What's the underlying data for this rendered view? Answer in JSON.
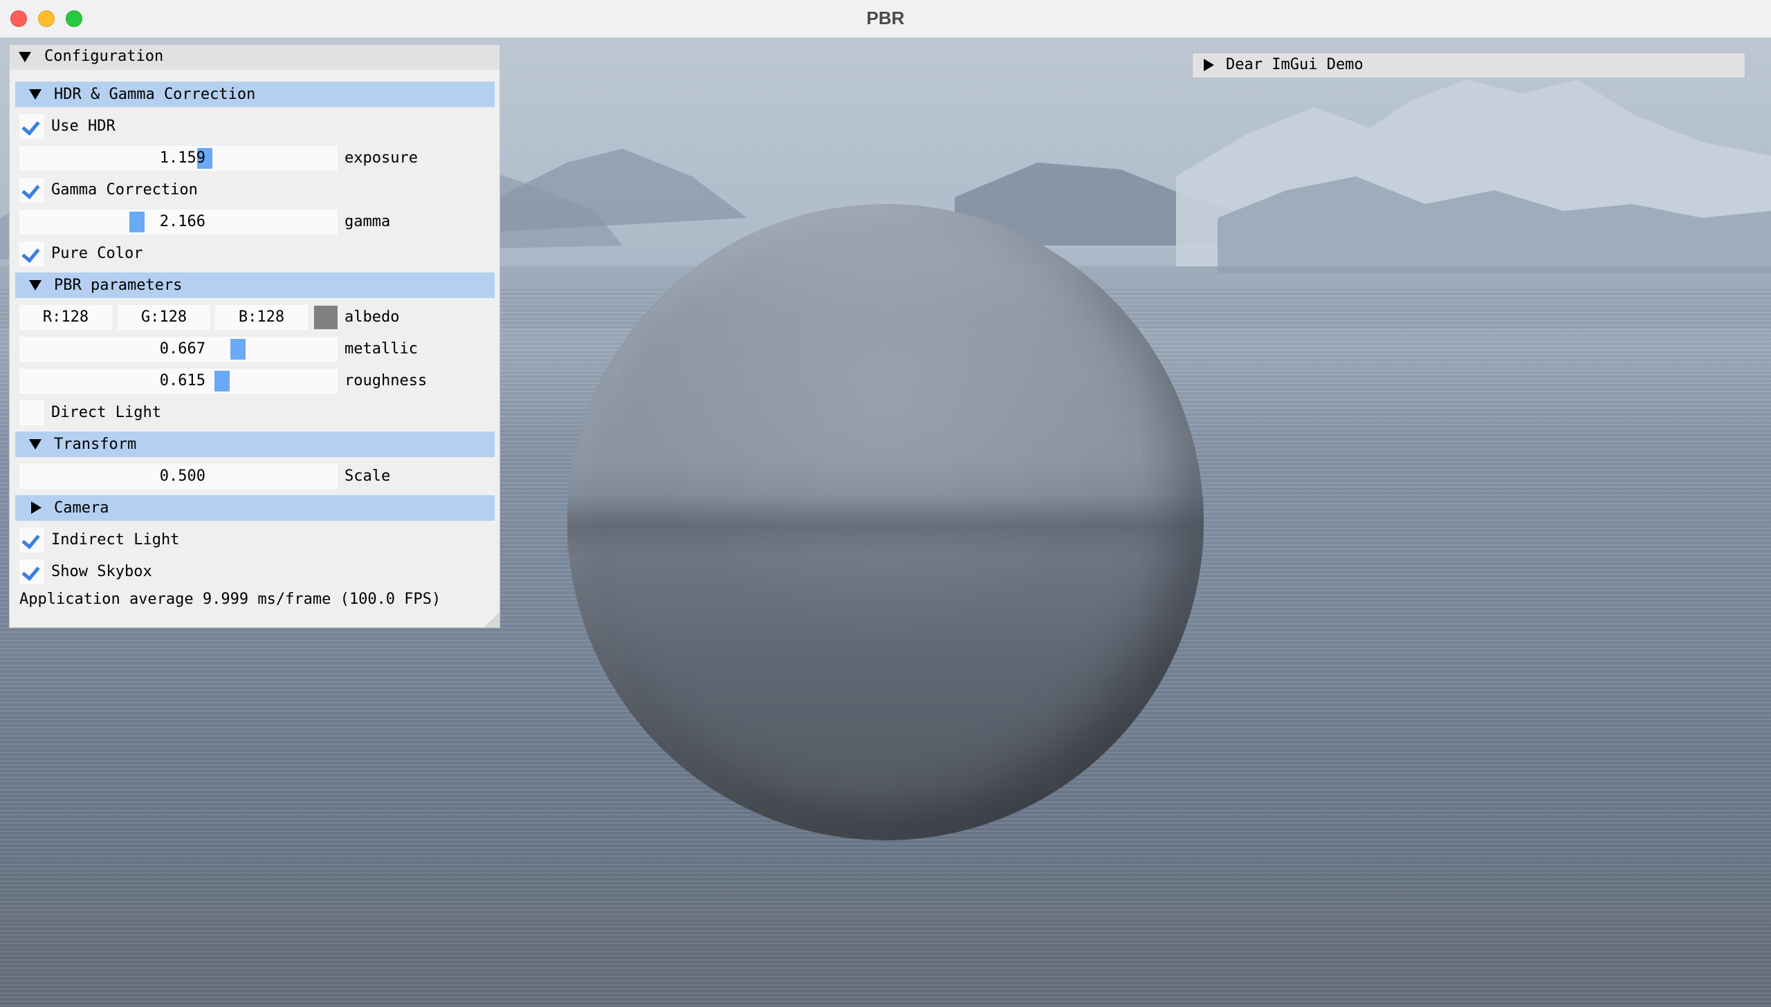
{
  "window": {
    "title": "PBR"
  },
  "config_window": {
    "title": "Configuration",
    "sections": {
      "hdr": {
        "label": "HDR & Gamma Correction",
        "expanded": true
      },
      "pbr": {
        "label": "PBR parameters",
        "expanded": true
      },
      "transform": {
        "label": "Transform",
        "expanded": true
      },
      "camera": {
        "label": "Camera",
        "expanded": false
      }
    },
    "use_hdr": {
      "label": "Use HDR",
      "checked": true
    },
    "exposure": {
      "value": "1.159",
      "label": "exposure"
    },
    "gamma_correction": {
      "label": "Gamma Correction",
      "checked": true
    },
    "gamma": {
      "value": "2.166",
      "label": "gamma"
    },
    "pure_color": {
      "label": "Pure Color",
      "checked": true
    },
    "albedo": {
      "r": "R:128",
      "g": "G:128",
      "b": "B:128",
      "label": "albedo",
      "color": "#808080"
    },
    "metallic": {
      "value": "0.667",
      "label": "metallic"
    },
    "roughness": {
      "value": "0.615",
      "label": "roughness"
    },
    "direct_light": {
      "label": "Direct Light",
      "checked": false
    },
    "scale": {
      "value": "0.500",
      "label": "Scale"
    },
    "indirect_light": {
      "label": "Indirect Light",
      "checked": true
    },
    "show_skybox": {
      "label": "Show Skybox",
      "checked": true
    },
    "stats": "Application average 9.999 ms/frame (100.0 FPS)"
  },
  "demo_window": {
    "title": "Dear ImGui Demo",
    "expanded": false
  },
  "colors": {
    "header_bg": "#b4cff0",
    "checkmark": "#3b7fe0",
    "slider_grab": "#6aa9f5",
    "window_bg": "#efefef"
  }
}
